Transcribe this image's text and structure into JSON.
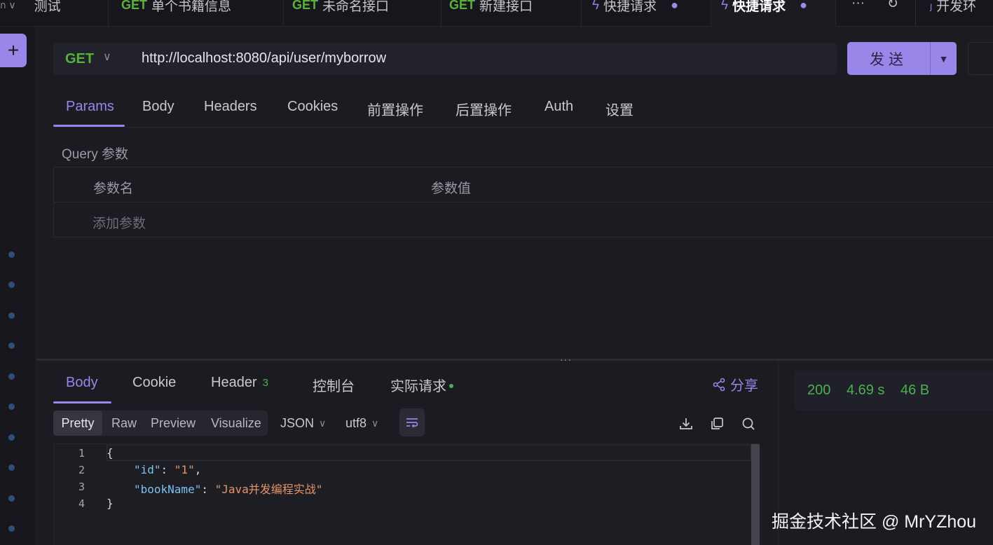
{
  "tabs": [
    {
      "label": "测试",
      "method": ""
    },
    {
      "label": "单个书籍信息",
      "method": "GET"
    },
    {
      "label": "未命名接口",
      "method": "GET"
    },
    {
      "label": "新建接口",
      "method": "GET"
    },
    {
      "label": "快捷请求",
      "icon": "bolt-icon"
    },
    {
      "label": "快捷请求",
      "icon": "bolt-icon"
    }
  ],
  "tabbar": {
    "more": "···",
    "env_label": "开发环"
  },
  "request": {
    "method": "GET",
    "url": "http://localhost:8080/api/user/myborrow",
    "send_label": "发送"
  },
  "request_tabs": [
    "Params",
    "Body",
    "Headers",
    "Cookies",
    "前置操作",
    "后置操作",
    "Auth",
    "设置"
  ],
  "params": {
    "title": "Query 参数",
    "col_name": "参数名",
    "col_value": "参数值",
    "add_placeholder": "添加参数"
  },
  "response": {
    "tabs": [
      "Body",
      "Cookie",
      "Header",
      "控制台",
      "实际请求"
    ],
    "header_count": "3",
    "share_label": "分享",
    "status": "200",
    "time": "4.69 s",
    "size": "46 B",
    "views": [
      "Pretty",
      "Raw",
      "Preview",
      "Visualize"
    ],
    "format": "JSON",
    "encoding": "utf8",
    "code_lines": [
      {
        "n": "1",
        "text": "{"
      },
      {
        "n": "2",
        "key": "\"id\"",
        "val": "\"1\"",
        "tail": ","
      },
      {
        "n": "3",
        "key": "\"bookName\"",
        "val": "\"Java并发编程实战\"",
        "tail": ""
      },
      {
        "n": "4",
        "text": "}"
      }
    ]
  },
  "watermark": "掘金技术社区 @ MrYZhou",
  "colors": {
    "accent": "#9a86e8",
    "method_get": "#57b13b",
    "status_ok": "#4caf50"
  }
}
